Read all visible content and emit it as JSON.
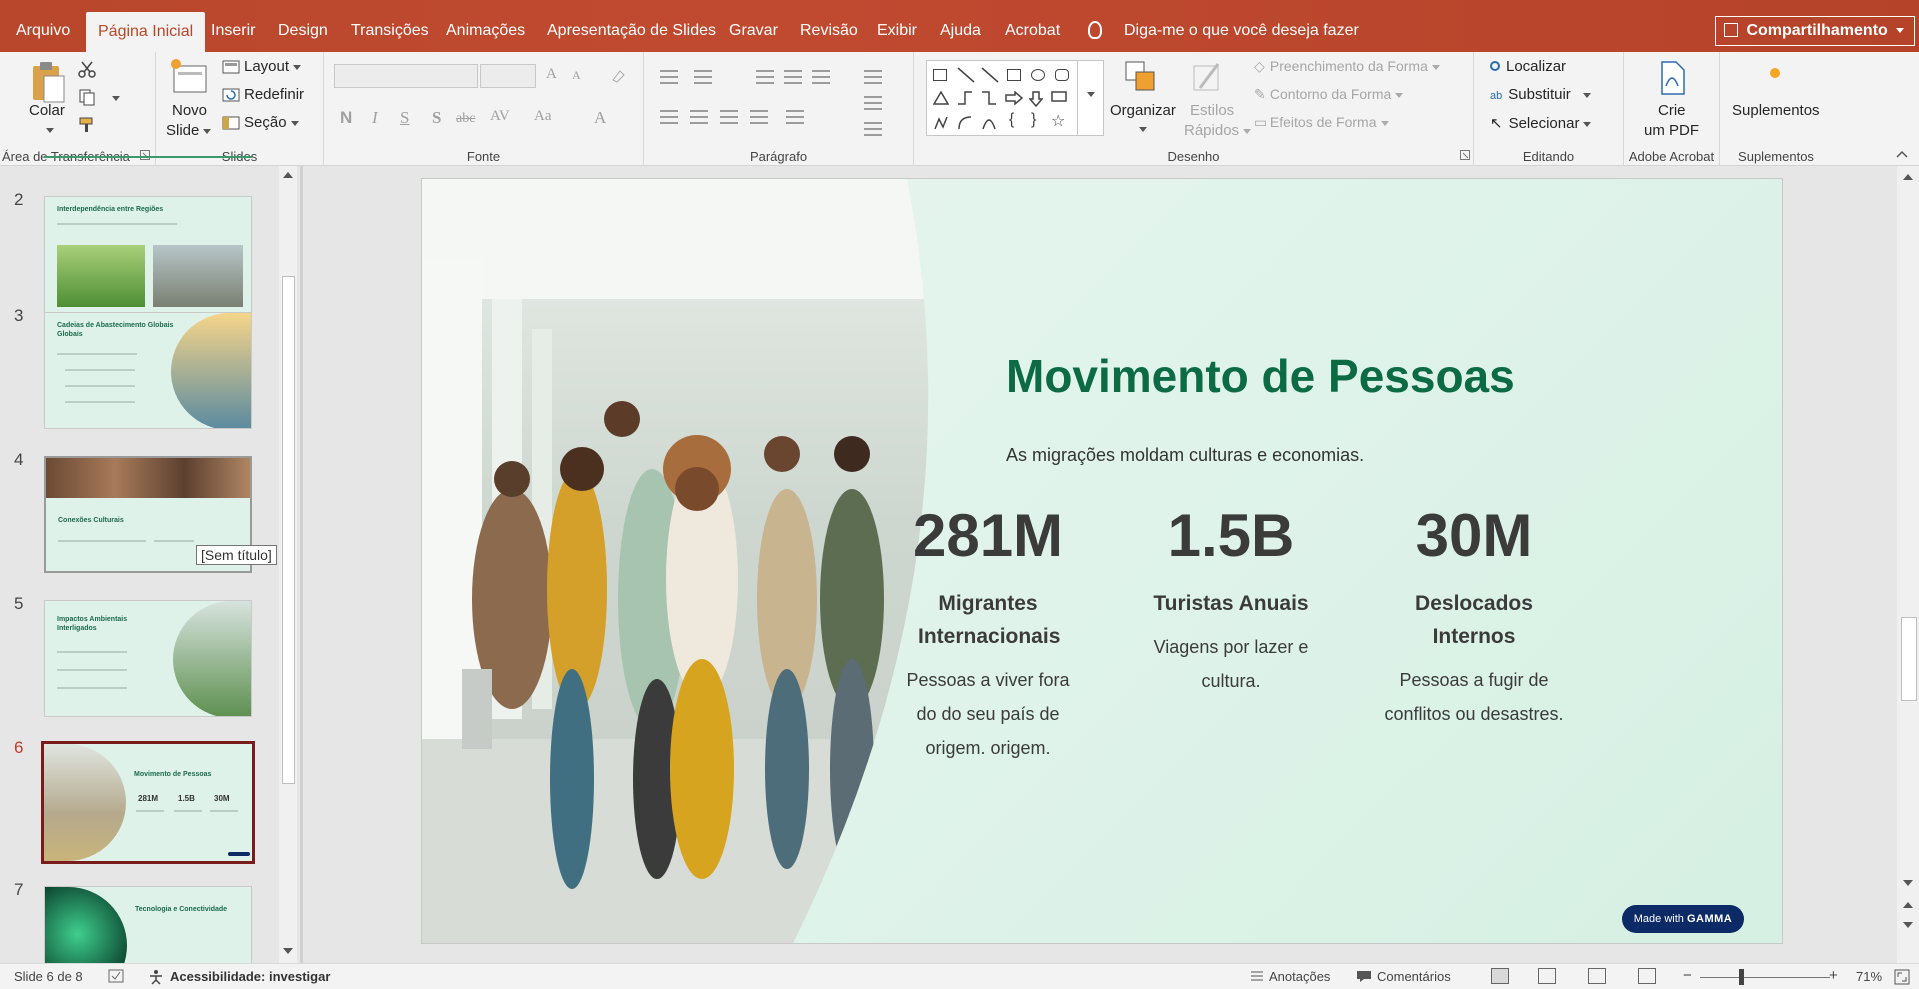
{
  "menu": {
    "file": "Arquivo",
    "tabs": [
      "Página Inicial",
      "Inserir",
      "Design",
      "Transições",
      "Animações",
      "Apresentação de Slides",
      "Gravar",
      "Revisão",
      "Exibir",
      "Ajuda",
      "Acrobat"
    ],
    "active_tab": "Página Inicial",
    "tell_me": "Diga-me o que você deseja fazer",
    "share": "Compartilhamento"
  },
  "ribbon": {
    "clipboard": {
      "paste": "Colar",
      "label": "Área de Transferência"
    },
    "slides": {
      "new_slide_1": "Novo",
      "new_slide_2": "Slide",
      "layout": "Layout",
      "reset": "Redefinir",
      "section": "Seção",
      "label": "Slides"
    },
    "font": {
      "bold": "N",
      "italic": "I",
      "underline": "S",
      "shadow": "S",
      "strike": "abc",
      "spacing": "AV",
      "case": "Aa",
      "color": "A",
      "grow": "A",
      "shrink": "A",
      "label": "Fonte"
    },
    "paragraph": {
      "label": "Parágrafo"
    },
    "drawing": {
      "arrange": "Organizar",
      "quick_styles_1": "Estilos",
      "quick_styles_2": "Rápidos",
      "fill": "Preenchimento da Forma",
      "outline": "Contorno da Forma",
      "effects": "Efeitos de Forma",
      "label": "Desenho"
    },
    "editing": {
      "find": "Localizar",
      "replace": "Substituir",
      "select": "Selecionar",
      "label": "Editando"
    },
    "acrobat": {
      "create_1": "Crie",
      "create_2": "um PDF",
      "label": "Adobe Acrobat"
    },
    "addins": {
      "button": "Suplementos",
      "label": "Suplementos"
    }
  },
  "thumbnails": [
    {
      "num": "2",
      "title": "Interdependência entre Regiões",
      "selected": false
    },
    {
      "num": "3",
      "title": "Cadeias de Abastecimento Globais Globais",
      "selected": false
    },
    {
      "num": "4",
      "title": "Conexões Culturais",
      "selected": false
    },
    {
      "num": "5",
      "title": "Impactos Ambientais Interligados",
      "selected": false
    },
    {
      "num": "6",
      "title": "Movimento de Pessoas",
      "selected": true
    },
    {
      "num": "7",
      "title": "Tecnologia e Conectividade",
      "selected": false
    }
  ],
  "thumb6": {
    "n1": "281M",
    "n2": "1.5B",
    "n3": "30M"
  },
  "tooltip": "[Sem título]",
  "slide": {
    "title": "Movimento de Pessoas",
    "subtitle": "As migrações moldam culturas e economias.",
    "stats": [
      {
        "number": "281M",
        "label": "Migrantes Internacionais",
        "desc": "Pessoas a viver fora do do seu país de origem. origem."
      },
      {
        "number": "1.5B",
        "label": "Turistas Anuais",
        "desc": "Viagens por lazer e cultura."
      },
      {
        "number": "30M",
        "label": "Deslocados Internos",
        "desc": "Pessoas a fugir de conflitos ou desastres."
      }
    ],
    "badge_prefix": "Made with",
    "badge_brand": "GAMMA"
  },
  "status": {
    "slide_info": "Slide 6 de 8",
    "accessibility": "Acessibilidade: investigar",
    "notes": "Anotações",
    "comments": "Comentários",
    "zoom": "71%",
    "minus": "−",
    "plus": "+"
  },
  "colors": {
    "accent": "#b7472a",
    "slide_title": "#0c6b45",
    "selected_thumb": "#7b1c1c",
    "badge": "#0b2a66"
  }
}
